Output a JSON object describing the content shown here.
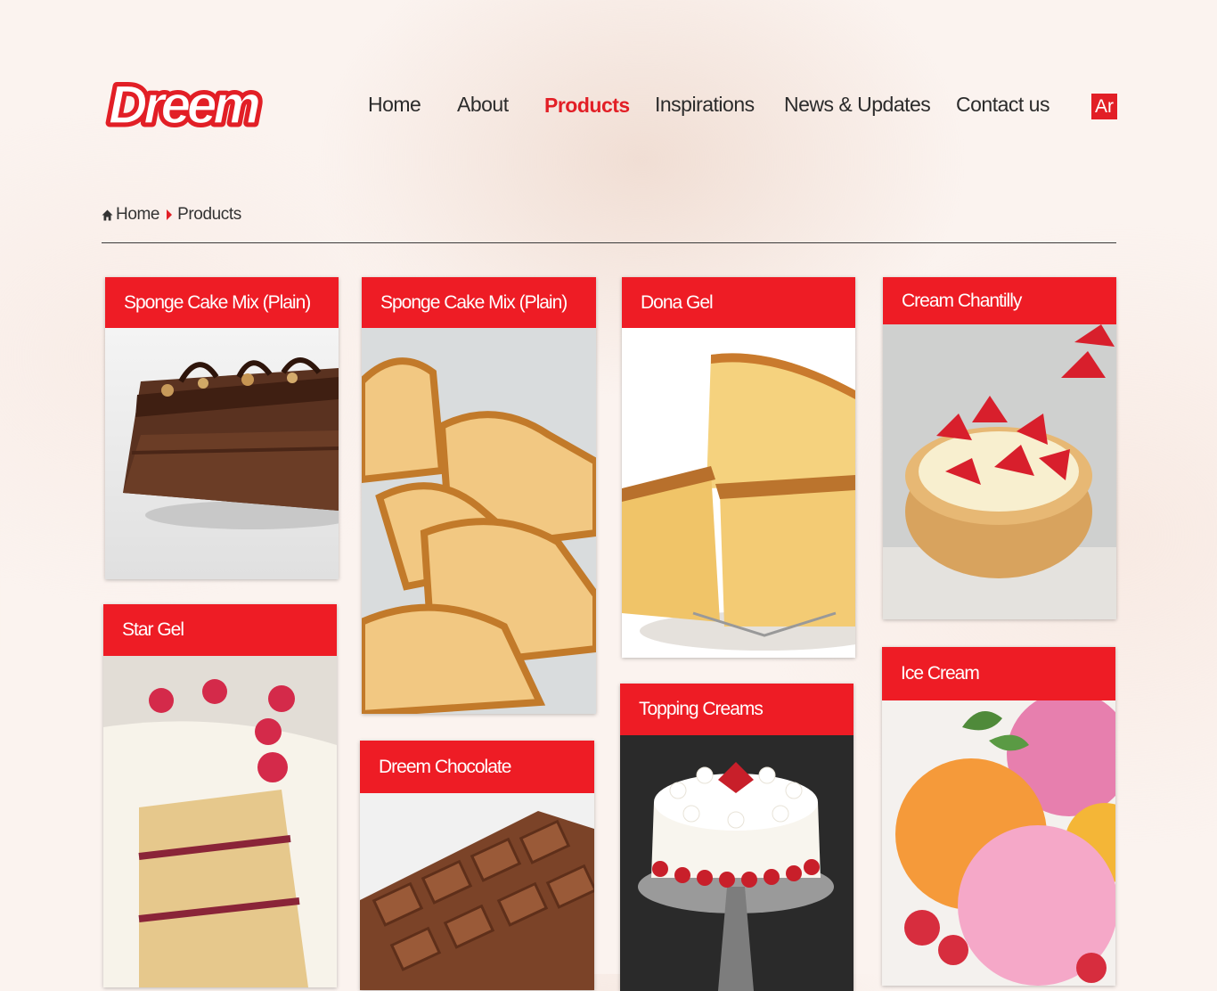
{
  "header": {
    "logo_text": "Dreem",
    "nav": [
      "Home",
      "About",
      "Products",
      "Inspirations",
      "News & Updates",
      "Contact us"
    ],
    "active": "Products",
    "lang_label": "Ar"
  },
  "breadcrumb": {
    "home": "Home",
    "current": "Products"
  },
  "products": [
    "Sponge Cake Mix (Plain)",
    "Sponge Cake Mix (Plain)",
    "Dona Gel",
    "Cream Chantilly",
    "Star Gel",
    "Dreem Chocolate",
    "Topping Creams",
    "Ice Cream"
  ],
  "colors": {
    "accent": "#ee1c25",
    "nav_text": "#2b2b2b",
    "background": "#fbf3ef"
  }
}
